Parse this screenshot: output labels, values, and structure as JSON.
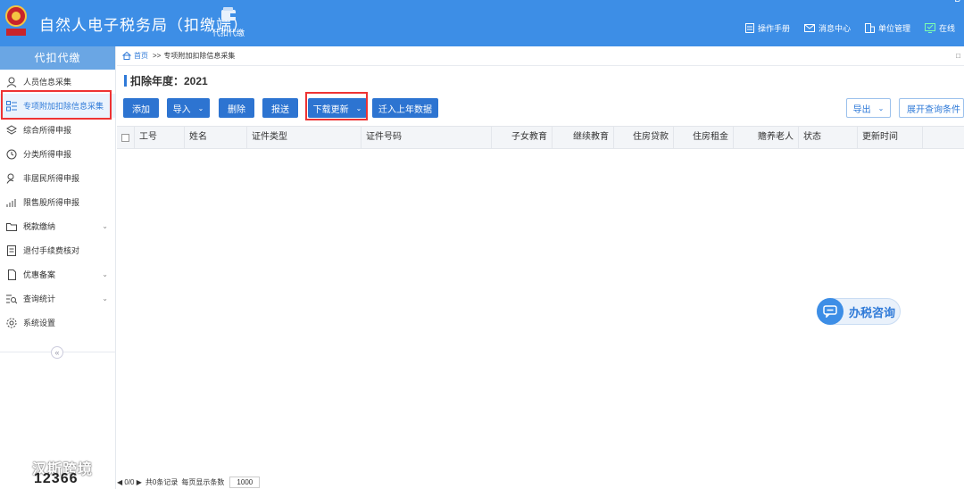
{
  "header": {
    "app_title": "自然人电子税务局（扣缴端）",
    "module_label": "代扣代缴",
    "links": [
      {
        "label": "操作手册",
        "icon": "document-icon"
      },
      {
        "label": "消息中心",
        "icon": "mail-icon"
      },
      {
        "label": "单位管理",
        "icon": "building-icon"
      },
      {
        "label": "在线",
        "icon": "online-icon"
      }
    ],
    "corner_mark": "B"
  },
  "sidebar": {
    "title": "代扣代缴",
    "items": [
      {
        "label": "人员信息采集",
        "icon": "person-icon"
      },
      {
        "label": "专项附加扣除信息采集",
        "icon": "list-icon",
        "active": true
      },
      {
        "label": "综合所得申报",
        "icon": "layers-icon"
      },
      {
        "label": "分类所得申报",
        "icon": "clock-icon"
      },
      {
        "label": "非居民所得申报",
        "icon": "user-outline-icon"
      },
      {
        "label": "限售股所得申报",
        "icon": "bar-chart-icon"
      },
      {
        "label": "税款缴纳",
        "icon": "folder-icon",
        "expandable": true
      },
      {
        "label": "退付手续费核对",
        "icon": "receipt-icon"
      },
      {
        "label": "优惠备案",
        "icon": "file-icon",
        "expandable": true
      },
      {
        "label": "查询统计",
        "icon": "search-list-icon",
        "expandable": true
      },
      {
        "label": "系统设置",
        "icon": "gear-icon"
      }
    ]
  },
  "breadcrumb": {
    "home": "首页",
    "separator": ">>",
    "current": "专项附加扣除信息采集"
  },
  "year_label": "扣除年度：2021",
  "toolbar": {
    "add": "添加",
    "import": "导入",
    "delete": "删除",
    "submit": "报送",
    "download_update": "下载更新",
    "migrate": "迁入上年数据",
    "export": "导出",
    "expand_query": "展开查询条件"
  },
  "table": {
    "columns": [
      "工号",
      "姓名",
      "证件类型",
      "证件号码",
      "子女教育",
      "继续教育",
      "住房贷款",
      "住房租金",
      "赡养老人",
      "状态",
      "更新时间"
    ]
  },
  "consult": {
    "label": "办税咨询"
  },
  "pager": {
    "nav": "◀ 0/0 ▶",
    "records": "共0条记录",
    "per_page_label": "每页显示条数",
    "per_page_value": "1000"
  },
  "watermark": {
    "text": "汉斯跨境",
    "number": "12366"
  },
  "colors": {
    "header_bg": "#3d8ee6",
    "primary_button": "#2d74d1",
    "highlight_border": "#e33333",
    "sidebar_head": "#6aa6e4"
  }
}
